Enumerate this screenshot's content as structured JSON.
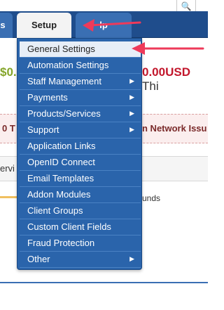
{
  "header": {
    "search_icon": "🔍"
  },
  "nav": {
    "tabs": [
      {
        "label": "s"
      },
      {
        "label": "Setup"
      },
      {
        "label": "lp"
      }
    ]
  },
  "stats": {
    "left_value": "$0.",
    "right_value": "0.00USD",
    "right_suffix": " Thi"
  },
  "alert": {
    "left_text": "0 T",
    "right_text": "n Network Issu"
  },
  "panel": {
    "header_text": "ervi",
    "funds_text": "unds"
  },
  "setup_menu": {
    "items": [
      {
        "label": "General Settings",
        "submenu": false,
        "active": true
      },
      {
        "label": "Automation Settings",
        "submenu": false
      },
      {
        "label": "Staff Management",
        "submenu": true
      },
      {
        "label": "Payments",
        "submenu": true
      },
      {
        "label": "Products/Services",
        "submenu": true
      },
      {
        "label": "Support",
        "submenu": true
      },
      {
        "label": "Application Links",
        "submenu": false
      },
      {
        "label": "OpenID Connect",
        "submenu": false
      },
      {
        "label": "Email Templates",
        "submenu": false
      },
      {
        "label": "Addon Modules",
        "submenu": false
      },
      {
        "label": "Client Groups",
        "submenu": false
      },
      {
        "label": "Custom Client Fields",
        "submenu": false
      },
      {
        "label": "Fraud Protection",
        "submenu": false
      },
      {
        "label": "Other",
        "submenu": true
      }
    ],
    "arrow_glyph": "▶"
  },
  "colors": {
    "nav_bg": "#1f4d8c",
    "menu_bg": "#2a64ab",
    "annotation_arrow": "#ee3a5a"
  }
}
